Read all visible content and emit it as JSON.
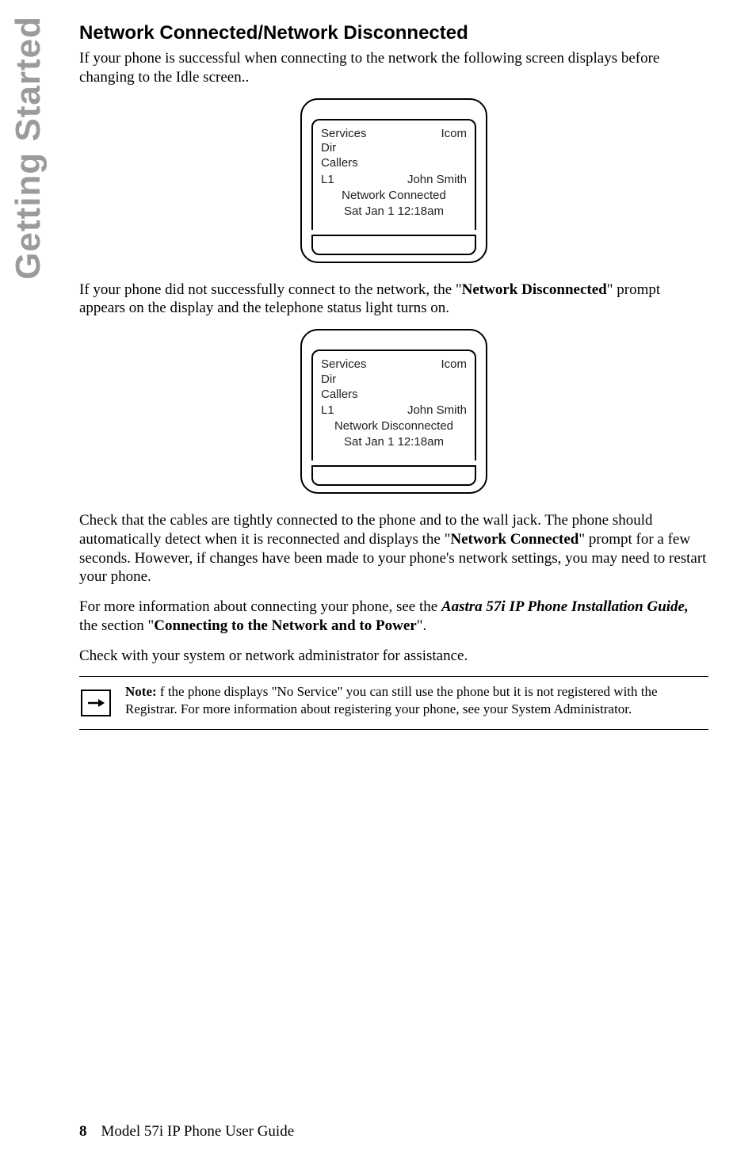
{
  "sideTab": "Getting Started",
  "heading": "Network Connected/Network Disconnected",
  "para1": "If your phone is successful when connecting to the network the following screen displays before changing to the Idle screen..",
  "screen1": {
    "servicesLabel": "Services",
    "icomLabel": "Icom",
    "dirLabel": "Dir",
    "callersLabel": "Callers",
    "lineLabel": "L1",
    "userName": "John Smith",
    "status": "Network Connected",
    "datetime": "Sat  Jan 1  12:18am"
  },
  "para2_a": "If your phone did not successfully connect to the network, the \"",
  "para2_bold": "Network Disconnected",
  "para2_b": "\" prompt appears on the display and the telephone status light turns on.",
  "screen2": {
    "servicesLabel": "Services",
    "icomLabel": "Icom",
    "dirLabel": "Dir",
    "callersLabel": "Callers",
    "lineLabel": "L1",
    "userName": "John Smith",
    "status": "Network Disconnected",
    "datetime": "Sat  Jan 1  12:18am"
  },
  "para3_a": "Check that the cables are tightly connected to the phone and to the wall jack. The phone should automatically detect when it is reconnected and displays the \"",
  "para3_bold": "Network Connected",
  "para3_b": "\" prompt for a few seconds. However, if changes have been made to your phone's network settings, you may need to restart your phone.",
  "para4_a": "For more information about connecting your phone, see the ",
  "para4_bi": "Aastra 57i IP Phone Installation Guide,",
  "para4_b": " the section \"",
  "para4_bold": "Connecting to the Network and to Power",
  "para4_c": "\".",
  "para5": "Check with your system or network administrator for assistance.",
  "note": {
    "label": "Note:",
    "text": " f the phone displays \"No Service\" you can still use the phone but it is not registered with the Registrar. For more information about registering your phone, see your System Administrator."
  },
  "footer": {
    "page": "8",
    "title": "Model 57i IP Phone User Guide"
  }
}
